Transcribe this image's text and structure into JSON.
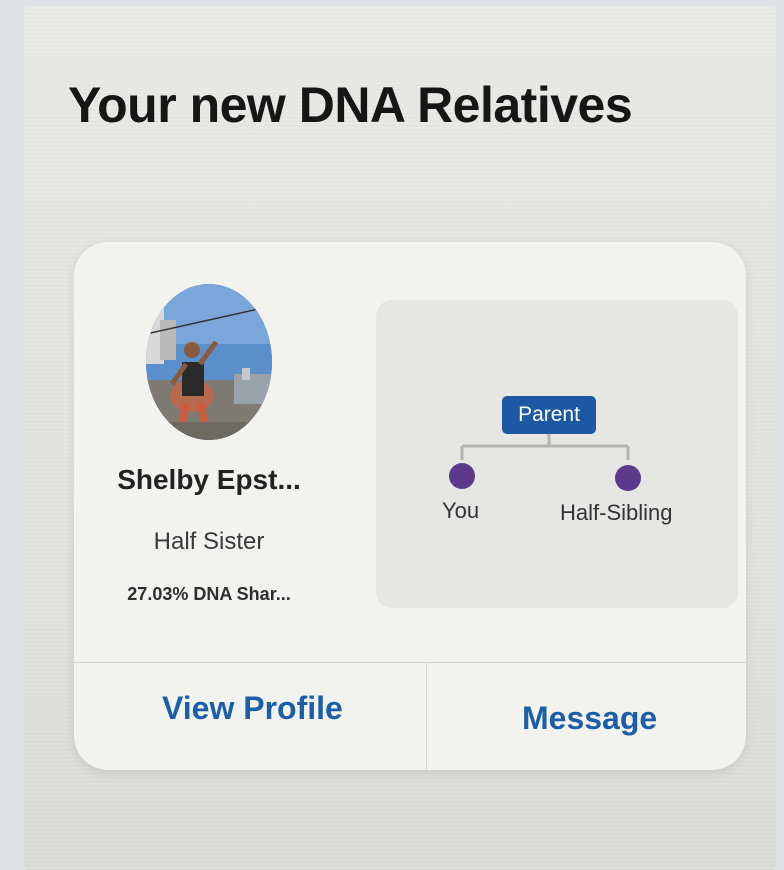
{
  "page": {
    "title": "Your new DNA Relatives"
  },
  "relative_card": {
    "name": "Shelby Epst...",
    "relationship": "Half Sister",
    "dna_shared": "27.03% DNA Shar...",
    "tree": {
      "parent_label": "Parent",
      "left_node_label": "You",
      "right_node_label": "Half-Sibling",
      "node_color": "#5b3a8c",
      "badge_color": "#1d58a3"
    },
    "actions": {
      "view_profile_label": "View Profile",
      "message_label": "Message"
    }
  },
  "colors": {
    "link": "#1c5fa7",
    "card_background": "#f2f2ee"
  }
}
